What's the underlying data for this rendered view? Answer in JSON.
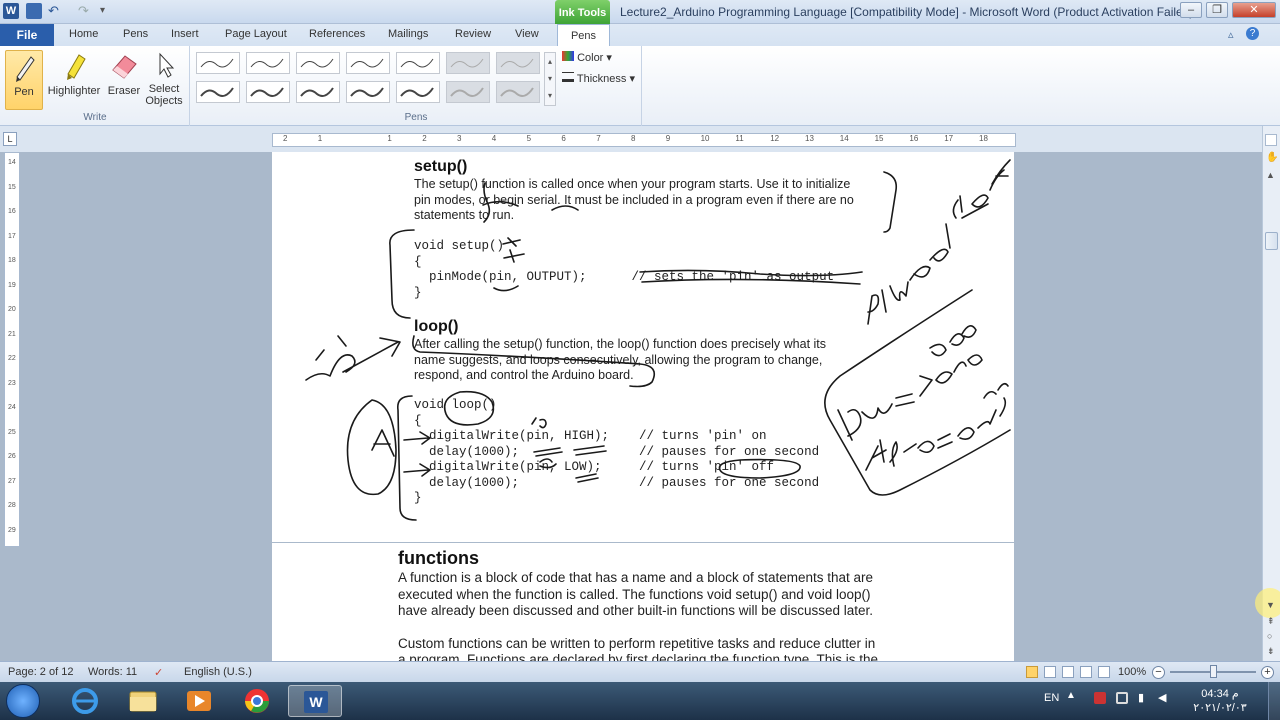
{
  "window": {
    "title": "Lecture2_Arduino Programming Language [Compatibility Mode] - Microsoft Word (Product Activation Failed)",
    "ink_tools_label": "Ink Tools",
    "minimize": "‒",
    "restore": "❐",
    "close": "✕"
  },
  "tabs": {
    "file": "File",
    "home": "Home",
    "pens": "Pens",
    "insert": "Insert",
    "page_layout": "Page Layout",
    "references": "References",
    "mailings": "Mailings",
    "review": "Review",
    "view": "View",
    "pens_active": "Pens"
  },
  "ribbon": {
    "write": {
      "label": "Write",
      "pen": "Pen",
      "highlighter": "Highlighter",
      "eraser": "Eraser",
      "select_objects_1": "Select",
      "select_objects_2": "Objects"
    },
    "pens_group": {
      "label": "Pens"
    },
    "color": "Color",
    "thickness": "Thickness"
  },
  "document": {
    "setup_heading": "setup()",
    "setup_body_1": "The setup() function is called once when your program starts. Use it to initialize",
    "setup_body_2": "pin modes, or begin serial. It must be included in a program even if there are no",
    "setup_body_3": "statements to run.",
    "setup_code_1": "void setup()",
    "setup_code_2": "{",
    "setup_code_3": "  pinMode(pin, OUTPUT);      // sets the 'pin' as output",
    "setup_code_4": "}",
    "loop_heading": "loop()",
    "loop_body_1": "After calling the setup() function, the loop() function does precisely what its",
    "loop_body_2": "name suggests, and loops consecutively, allowing the program to change,",
    "loop_body_3": "respond, and control the Arduino board.",
    "loop_code_1": "void loop()",
    "loop_code_2": "{",
    "loop_code_3": "  digitalWrite(pin, HIGH);    // turns 'pin' on",
    "loop_code_4": "  delay(1000);                // pauses for one second",
    "loop_code_5": "  digitalWrite(pin, LOW);     // turns 'pin' off",
    "loop_code_6": "  delay(1000);                // pauses for one second",
    "loop_code_7": "}",
    "functions_heading": "functions",
    "functions_body_1": "A function is a block of code that has a name and a block of statements that are",
    "functions_body_2": "executed when the function is called. The functions void setup() and void loop()",
    "functions_body_3": "have already been discussed and other built-in functions will be discussed later.",
    "functions_body_4": "Custom functions can be written to perform repetitive tasks and reduce clutter in",
    "functions_body_5": "a program. Functions are declared by first declaring the function type. This is the"
  },
  "status": {
    "page": "Page: 2 of 12",
    "words": "Words: 11",
    "language": "English (U.S.)",
    "zoom": "100%"
  },
  "taskbar": {
    "lang": "EN",
    "time": "04:34 م",
    "date": "٢٠٢١/٠٢/٠٣"
  },
  "colors": {
    "file_tab": "#2a5eab",
    "ink_tools": "#3ea336",
    "ink": "#1a1a1a"
  }
}
